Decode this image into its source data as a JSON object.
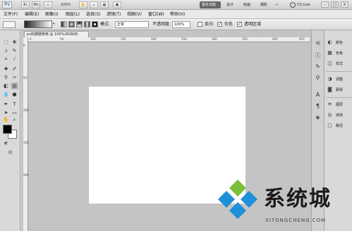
{
  "app": {
    "logo": "Ps",
    "zoom": "100%"
  },
  "appbar": {
    "workspaces": [
      "基本功能",
      "设计",
      "绘画",
      "摄影"
    ],
    "more": "»",
    "cs_live": "CS Live",
    "window_controls": [
      "–",
      "□",
      "×"
    ]
  },
  "menu": [
    "文件(F)",
    "编辑(E)",
    "图像(I)",
    "图层(L)",
    "选择(S)",
    "滤镜(T)",
    "视图(V)",
    "窗口(W)",
    "帮助(H)"
  ],
  "options": {
    "mode_label": "模式:",
    "mode_value": "正常",
    "opacity_label": "不透明度:",
    "opacity_value": "100%",
    "reverse_label": "反向",
    "dither_label": "仿色",
    "transparency_label": "透明区域",
    "reverse_checked": false,
    "dither_checked": true,
    "transparency_checked": true
  },
  "document": {
    "tab_title": "ps快捷键使用 @ 100%(RGB/8)",
    "ruler_h": [
      "0",
      "50",
      "100",
      "150",
      "200",
      "250",
      "300",
      "350",
      "400",
      "450"
    ],
    "ruler_v": [
      "0",
      "50",
      "100",
      "150",
      "200"
    ]
  },
  "panels": {
    "group1": [
      "颜色",
      "色板",
      "样式"
    ],
    "group2": [
      "调整",
      "蒙版"
    ],
    "group3": [
      "图层",
      "通道",
      "路径"
    ]
  },
  "watermark": {
    "text": "系统城",
    "url": "XITONGCHENG.COM"
  },
  "colors": {
    "foreground": "#000000",
    "background": "#ffffff",
    "canvas": "#ffffff",
    "workspace": "#c4c4c4"
  }
}
